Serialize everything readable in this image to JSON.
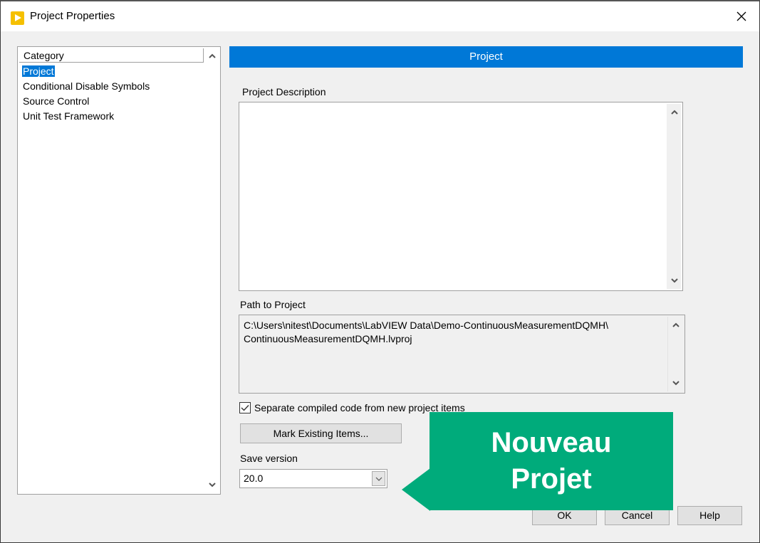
{
  "window": {
    "title": "Project Properties",
    "icon": "labview-app-icon",
    "close_icon": "close-icon"
  },
  "category_list": {
    "header": "Category",
    "items": [
      {
        "label": "Project",
        "selected": true
      },
      {
        "label": "Conditional Disable Symbols",
        "selected": false
      },
      {
        "label": "Source Control",
        "selected": false
      },
      {
        "label": "Unit Test Framework",
        "selected": false
      }
    ]
  },
  "section": {
    "title": "Project",
    "accent_color": "#0078d7"
  },
  "project_description": {
    "label": "Project Description",
    "value": ""
  },
  "path_to_project": {
    "label": "Path to Project",
    "value": "C:\\Users\\nitest\\Documents\\LabVIEW Data\\Demo-ContinuousMeasurementDQMH\\ContinuousMeasurementDQMH.lvproj",
    "line1": "C:\\Users\\nitest\\Documents\\LabVIEW Data\\Demo-ContinuousMeasurementDQMH\\",
    "line2": "ContinuousMeasurementDQMH.lvproj"
  },
  "separate_compiled": {
    "label": "Separate compiled code from new project items",
    "checked": true
  },
  "buttons": {
    "mark_existing": "Mark Existing Items...",
    "ok": "OK",
    "cancel": "Cancel",
    "help": "Help"
  },
  "save_version": {
    "label": "Save version",
    "value": "20.0"
  },
  "callout": {
    "line1": "Nouveau",
    "line2": "Projet",
    "color": "#00ab7b"
  }
}
